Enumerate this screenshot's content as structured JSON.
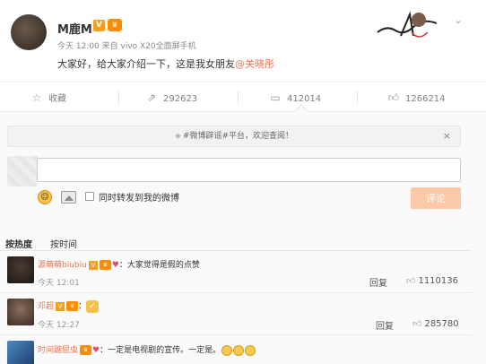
{
  "post": {
    "username": "M鹿M",
    "v_badge": "V",
    "vip_badge": "VIP",
    "meta": "今天 12:00 来自 vivo X20全面屏手机",
    "text_before": "大家好，给大家介绍一下，这是我女朋友",
    "mention": "@关晓彤"
  },
  "actions": {
    "favorite_label": "收藏",
    "forward_count": "292623",
    "comment_count": "412014",
    "like_count": "1266214"
  },
  "comment_box": {
    "notice": "#微博辟谣#平台，欢迎查阅！",
    "notice_close": "×",
    "input_value": "",
    "forward_label": "同时转发到我的微博",
    "submit_label": "评论"
  },
  "sort": {
    "hot": "按热度",
    "time": "按时间"
  },
  "comments": [
    {
      "name": "源萌萌biubiu",
      "text": "：大家觉得是假的点赞",
      "time": "今天 12:01",
      "reply": "回复",
      "likes": "1110136"
    },
    {
      "name": "邓超",
      "text": "：",
      "time": "今天 12:27",
      "reply": "回复",
      "likes": "285780"
    },
    {
      "name": "时间踮屁虫",
      "text": "：一定是电视剧的宣传。一定是。",
      "time": "",
      "reply": "",
      "likes": ""
    }
  ],
  "colors": {
    "mention": "#eb7350",
    "submit_bg": "#fcc9a8",
    "badge_orange": "#f4a01c"
  },
  "icons": [
    "star-icon",
    "forward-icon",
    "comment-icon",
    "thumb-up-icon",
    "chevron-down-icon",
    "emoji-icon",
    "image-icon",
    "close-icon"
  ]
}
